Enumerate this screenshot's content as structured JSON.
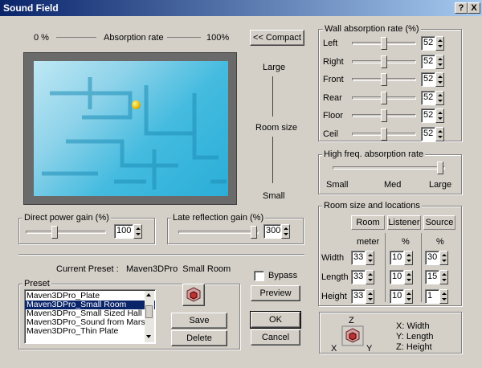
{
  "window": {
    "title": "Sound Field",
    "help_label": "?",
    "close_label": "X"
  },
  "absorption": {
    "min_label": "0 %",
    "title": "Absorption rate",
    "max_label": "100%"
  },
  "compact_button": "<< Compact",
  "room_size": {
    "large_label": "Large",
    "title": "Room size",
    "small_label": "Small"
  },
  "wall": {
    "title": "Wall absorption rate (%)",
    "rows": [
      {
        "label": "Left",
        "value": "52"
      },
      {
        "label": "Right",
        "value": "52"
      },
      {
        "label": "Front",
        "value": "52"
      },
      {
        "label": "Rear",
        "value": "52"
      },
      {
        "label": "Floor",
        "value": "52"
      },
      {
        "label": "Ceil",
        "value": "52"
      }
    ]
  },
  "high_freq": {
    "title": "High freq. absorption rate",
    "small": "Small",
    "med": "Med",
    "large": "Large"
  },
  "direct_gain": {
    "title": "Direct power gain (%)",
    "value": "100"
  },
  "late_gain": {
    "title": "Late reflection gain (%)",
    "value": "300"
  },
  "room_loc": {
    "title": "Room size and locations",
    "col_room": "Room",
    "col_listener": "Listener",
    "col_source": "Source",
    "unit_room": "meter",
    "unit_listener": "%",
    "unit_source": "%",
    "rows": [
      {
        "label": "Width",
        "room": "33",
        "listener": "10",
        "source": "30"
      },
      {
        "label": "Length",
        "room": "33",
        "listener": "10",
        "source": "15"
      },
      {
        "label": "Height",
        "room": "33",
        "listener": "10",
        "source": "1"
      }
    ]
  },
  "preset": {
    "current_label": "Current Preset :",
    "current_value": "Maven3DPro  Small Room",
    "group_title": "Preset",
    "items": [
      "Maven3DPro_Plate",
      "Maven3DPro_Small Room",
      "Maven3DPro_Small Sized Hall",
      "Maven3DPro_Sound from Mars",
      "Maven3DPro_Thin Plate"
    ],
    "selected_index": 1
  },
  "buttons": {
    "save": "Save",
    "delete": "Delete",
    "preview": "Preview",
    "ok": "OK",
    "cancel": "Cancel"
  },
  "bypass_label": "Bypass",
  "axes": {
    "z": "Z",
    "x": "X",
    "y": "Y",
    "x_desc": "X: Width",
    "y_desc": "Y: Length",
    "z_desc": "Z: Height"
  }
}
